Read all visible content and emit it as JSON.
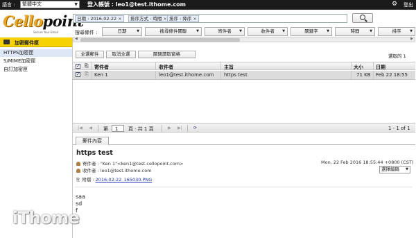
{
  "topbar": {
    "language_label": "語言 :",
    "language_value": "繁體中文",
    "account_label": "登入帳號 : leo1@test.ithome.com",
    "settings_icon": "gear-icon",
    "logout_label": "登出"
  },
  "logo": {
    "brand_a": "Cello",
    "brand_b": "point",
    "tagline": "Secure Your Email"
  },
  "sidebar": {
    "header": "加密郵件匣",
    "items": [
      {
        "label": "HTTPS加密匣",
        "selected": true
      },
      {
        "label": "S/MIME加密匣",
        "selected": false
      },
      {
        "label": "自訂加密匣",
        "selected": false
      }
    ]
  },
  "search": {
    "chips": [
      "日期 : 2016-02-22",
      "排序方式 : 時間",
      "排序 : 降序"
    ],
    "chip_close": "×",
    "button_icon": "search-icon"
  },
  "criteria": {
    "label": "搜尋條件 :",
    "items": [
      "日期",
      "搜尋條件關聯",
      "寄件者",
      "收件者",
      "關鍵字",
      "時間",
      "排序"
    ]
  },
  "actions": {
    "select_all": "全選郵件",
    "deselect_all": "取消全選",
    "close_reading_pane": "關閉讀取窗格",
    "selected_count": "選取的 1"
  },
  "table": {
    "columns": [
      "寄件者",
      "收件者",
      "主旨",
      "大小",
      "日期"
    ],
    "rows": [
      {
        "from": "Ken 1",
        "to": "leo1@test.ithome.com",
        "subject": "https test",
        "size": "71 KB",
        "date": "Feb 22 18:55",
        "checked": true
      }
    ]
  },
  "pager": {
    "page_label": "第",
    "page_value": "1",
    "page_of": "頁 ‧ 共 1 頁",
    "summary": "1 - 1 of 1"
  },
  "content": {
    "tab": "郵件內容",
    "subject": "https test",
    "from_label": "寄件者 :",
    "from_value": "\"Ken 1\"<ken1@test.cellopoint.com>",
    "to_label": "收件者 :",
    "to_value": "leo1@test.ithome.com",
    "attach_label": "附檔 :",
    "attach_value": "2016-02-22_165030.PNG",
    "date": "Mon, 22 Feb 2016 18:55:44 +0800 (CST)",
    "encoding": "選擇編碼",
    "body": [
      "saa",
      "sd",
      "f"
    ]
  },
  "watermark": "iThome",
  "colors": {
    "topbar": "#1b1b1b",
    "sidebar_header": "#f6d200",
    "selected_row": "#dcdcdc",
    "logo_orange": "#f2a51a"
  }
}
